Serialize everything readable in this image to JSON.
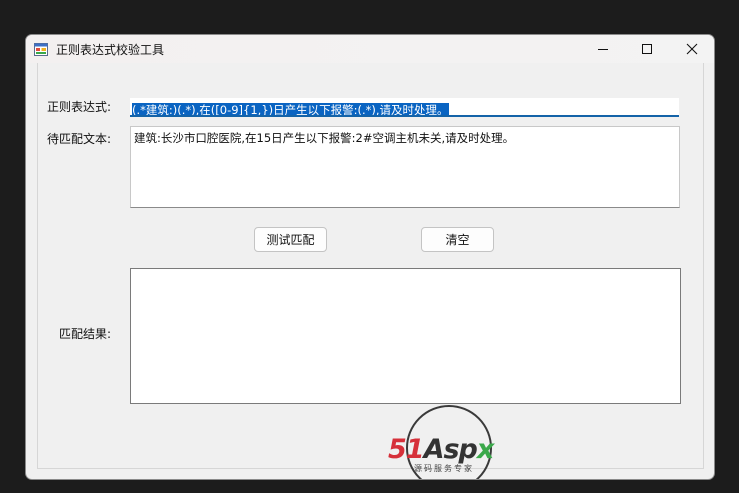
{
  "window": {
    "title": "正则表达式校验工具",
    "icons": {
      "app": "app-form-icon",
      "minimize": "minimize-icon",
      "maximize": "maximize-icon",
      "close": "close-icon"
    }
  },
  "form": {
    "regex_label": "正则表达式:",
    "regex_value": "(.*建筑:)(.*),在([0-9]{1,})日产生以下报警:(.*),请及时处理。",
    "text_label": "待匹配文本:",
    "text_value": "建筑:长沙市口腔医院,在15日产生以下报警:2#空调主机未关,请及时处理。",
    "test_button": "测试匹配",
    "clear_button": "清空",
    "result_label": "匹配结果:",
    "result_value": ""
  },
  "watermark": {
    "part1": "51",
    "part2": "Asp",
    "part3": "x",
    "subtitle": "源码服务专家"
  },
  "colors": {
    "selection": "#0a64c2",
    "focus_underline": "#1463a8",
    "watermark_red": "#d6303a",
    "watermark_green": "#3aa84a"
  }
}
